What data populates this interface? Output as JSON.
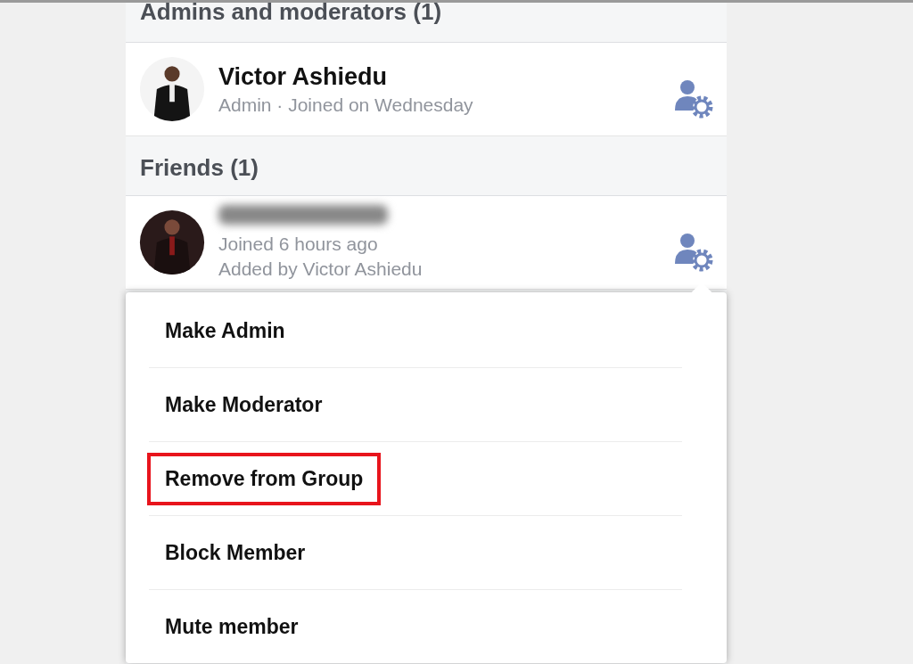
{
  "sections": [
    {
      "title": "Admins and moderators (1)",
      "members": [
        {
          "name": "Victor Ashiedu",
          "name_blurred": false,
          "details": [
            "Admin · Joined on Wednesday"
          ]
        }
      ]
    },
    {
      "title": "Friends (1)",
      "members": [
        {
          "name_blurred": true,
          "details": [
            "Joined 6 hours ago",
            "Added by Victor Ashiedu"
          ]
        }
      ]
    }
  ],
  "menu": {
    "items": [
      {
        "label": "Make Admin",
        "highlighted": false
      },
      {
        "label": "Make Moderator",
        "highlighted": false
      },
      {
        "label": "Remove from Group",
        "highlighted": true
      },
      {
        "label": "Block Member",
        "highlighted": false
      },
      {
        "label": "Mute member",
        "highlighted": false
      }
    ]
  }
}
